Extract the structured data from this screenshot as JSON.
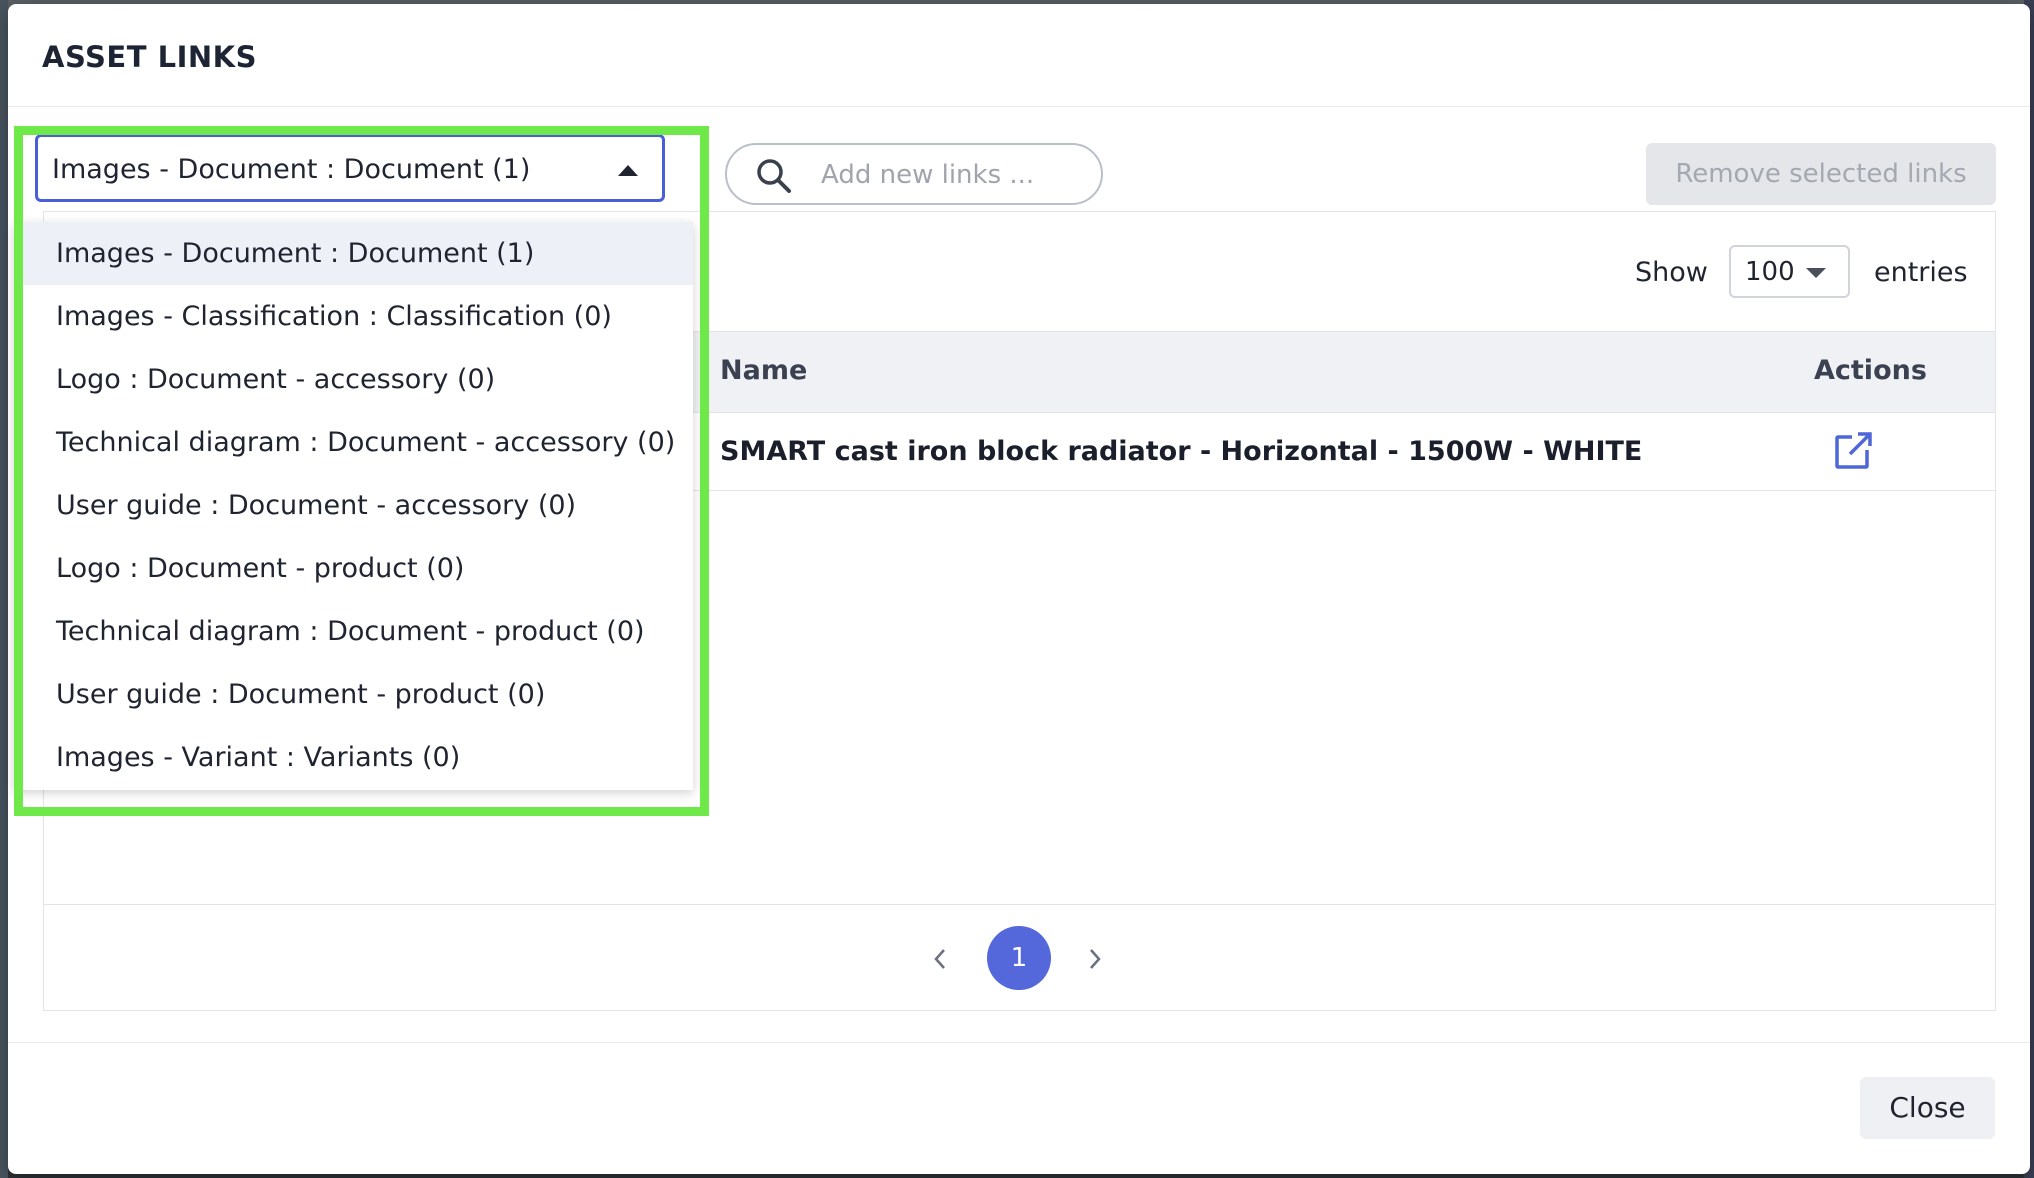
{
  "modal": {
    "title": "ASSET LINKS"
  },
  "link_type_select": {
    "selected": "Images - Document : Document (1)",
    "options": [
      "Images - Document : Document (1)",
      "Images - Classification : Classification (0)",
      "Logo : Document - accessory (0)",
      "Technical diagram : Document - accessory (0)",
      "User guide : Document - accessory (0)",
      "Logo : Document - product (0)",
      "Technical diagram : Document - product (0)",
      "User guide : Document - product (0)",
      "Images - Variant : Variants (0)"
    ]
  },
  "search": {
    "placeholder": "Add new links ..."
  },
  "toolbar": {
    "remove_label": "Remove selected links"
  },
  "table": {
    "show_label": "Show",
    "page_size": "100",
    "entries_label": "entries",
    "columns": [
      "Name",
      "Actions"
    ],
    "rows": [
      {
        "name": "SMART cast iron block radiator - Horizontal - 1500W - WHITE"
      }
    ]
  },
  "pagination": {
    "current_page": "1"
  },
  "footer": {
    "close_label": "Close"
  },
  "colors": {
    "accent": "#5468dc",
    "highlight": "#6fe94a"
  }
}
